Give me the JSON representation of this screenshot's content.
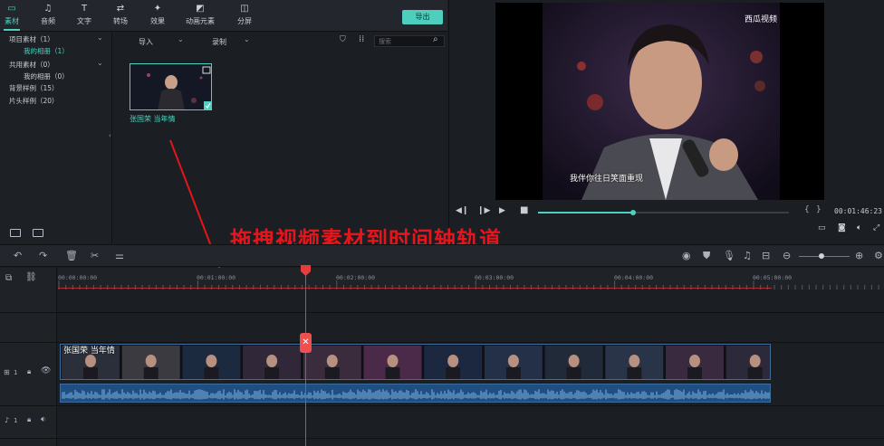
{
  "toolbar": {
    "tabs": [
      {
        "label": "素材",
        "icon": "media-folder-icon",
        "glyph": "▭"
      },
      {
        "label": "音频",
        "icon": "music-note-icon",
        "glyph": "♫"
      },
      {
        "label": "文字",
        "icon": "text-icon",
        "glyph": "T"
      },
      {
        "label": "转场",
        "icon": "transition-icon",
        "glyph": "⇄"
      },
      {
        "label": "效果",
        "icon": "effects-icon",
        "glyph": "✦"
      },
      {
        "label": "动画元素",
        "icon": "animation-icon",
        "glyph": "◩"
      },
      {
        "label": "分屏",
        "icon": "split-screen-icon",
        "glyph": "◫"
      }
    ],
    "export_label": "导出"
  },
  "library": {
    "items": [
      {
        "label": "项目素材（1）",
        "selected": false
      },
      {
        "label": "我的相册（1）",
        "selected": true
      },
      {
        "label": "共用素材（0）",
        "selected": false
      },
      {
        "label": "我的相册（0）",
        "selected": false
      },
      {
        "label": "背景样例（15）",
        "selected": false
      },
      {
        "label": "片头样例（20）",
        "selected": false
      }
    ]
  },
  "media": {
    "import_label": "导入",
    "record_label": "录制",
    "search_placeholder": "搜索",
    "clip_caption": "张国荣 当年情"
  },
  "preview": {
    "subtitle": "我伴你往日笑面重现",
    "watermark": "西瓜视频",
    "timecode": "00:01:46:23",
    "progress": 0.38
  },
  "annotation": "拖拽视频素材到时间轴轨道",
  "timeline": {
    "ticks": [
      "00:00:00:00",
      "00:01:00:00",
      "00:02:00:00",
      "00:03:00:00",
      "00:04:00:00",
      "00:05:00:00"
    ],
    "clip_title": "张国荣 当年情",
    "video_track_number": "1",
    "audio_track_number": "1"
  },
  "colors": {
    "accent": "#4fd1bf",
    "annotation": "#e8141c",
    "playhead": "#e63c3c",
    "audio": "#1f4f82"
  }
}
